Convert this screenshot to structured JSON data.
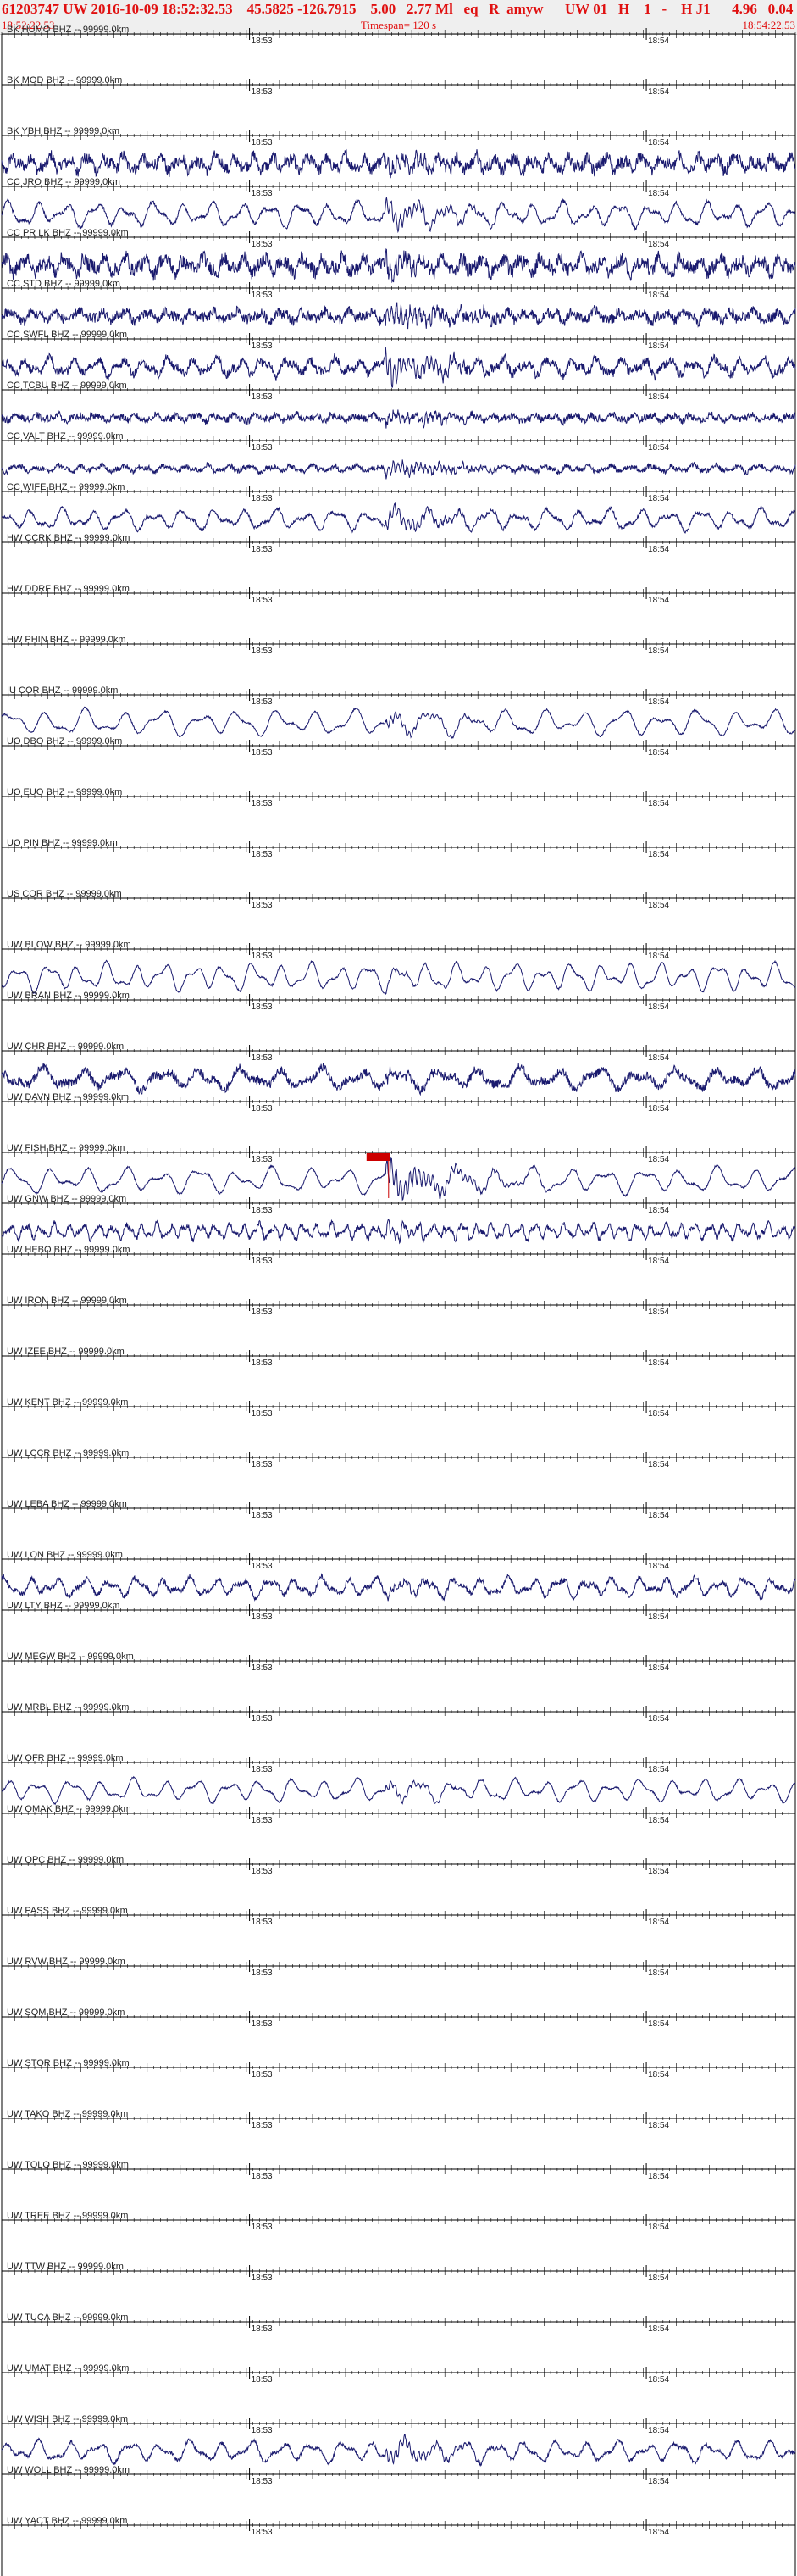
{
  "header": {
    "main": "61203747 UW 2016-10-09 18:52:32.53    45.5825 -126.7915    5.00   2.77 Ml   eq   R  amyw      UW 01   H    1   -    H J1      4.96   0.04",
    "start_time": "18:52:22.53",
    "timespan": "Timespan= 120 s",
    "end_time": "18:54:22.53"
  },
  "colors": {
    "trace": "#1a1a6e",
    "axis": "#000000",
    "header_text": "#e01010",
    "pick": "#cc0000"
  },
  "chart_data": {
    "type": "line",
    "title": "61203747 UW 2016-10-09 18:52:32.53",
    "time_window": [
      "18:52:22.53",
      "18:54:22.53"
    ],
    "timespan_s": 120,
    "minute_marks": [
      "18:53",
      "18:54"
    ],
    "channels": [
      {
        "label": "BK HUMO BHZ -- 99999.0km",
        "amp": 0,
        "noise": 0,
        "period": 0,
        "burst": 0
      },
      {
        "label": "BK MOD BHZ -- 99999.0km",
        "amp": 0,
        "noise": 0,
        "period": 0,
        "burst": 0
      },
      {
        "label": "BK YBH BHZ -- 99999.0km",
        "amp": 9,
        "noise": 7,
        "period": 28,
        "burst": 8
      },
      {
        "label": "CC JRO BHZ -- 99999.0km",
        "amp": 14,
        "noise": 2,
        "period": 44,
        "burst": 10
      },
      {
        "label": "CC PR LK BHZ -- 99999.0km",
        "amp": 10,
        "noise": 8,
        "period": 30,
        "burst": 10
      },
      {
        "label": "CC STD BHZ -- 99999.0km",
        "amp": 6,
        "noise": 6,
        "period": 34,
        "burst": 12
      },
      {
        "label": "CC SWFL BHZ -- 99999.0km",
        "amp": 10,
        "noise": 5,
        "period": 36,
        "burst": 14
      },
      {
        "label": "CC TCBU BHZ -- 99999.0km",
        "amp": 4,
        "noise": 4,
        "period": 30,
        "burst": 8
      },
      {
        "label": "CC VALT BHZ -- 99999.0km",
        "amp": 4,
        "noise": 3,
        "period": 32,
        "burst": 8
      },
      {
        "label": "CC WIFE BHZ -- 99999.0km",
        "amp": 12,
        "noise": 2,
        "period": 46,
        "burst": 8
      },
      {
        "label": "HW CCRK BHZ -- 99999.0km",
        "amp": 0,
        "noise": 0,
        "period": 0,
        "burst": 0
      },
      {
        "label": "HW DDRF BHZ -- 99999.0km",
        "amp": 0,
        "noise": 0,
        "period": 0,
        "burst": 0
      },
      {
        "label": "HW PHIN BHZ -- 99999.0km",
        "amp": 0,
        "noise": 0,
        "period": 0,
        "burst": 0
      },
      {
        "label": "IU COR BHZ -- 99999.0km",
        "amp": 15,
        "noise": 1,
        "period": 58,
        "burst": 5
      },
      {
        "label": "UO DBO BHZ -- 99999.0km",
        "amp": 0,
        "noise": 0,
        "period": 0,
        "burst": 0
      },
      {
        "label": "UO EUO BHZ -- 99999.0km",
        "amp": 0,
        "noise": 0,
        "period": 0,
        "burst": 0
      },
      {
        "label": "UO PIN BHZ -- 99999.0km",
        "amp": 0,
        "noise": 0,
        "period": 0,
        "burst": 0
      },
      {
        "label": "US COR BHZ -- 99999.0km",
        "amp": 0,
        "noise": 0,
        "period": 0,
        "burst": 0
      },
      {
        "label": "UW BLOW BHZ -- 99999.0km",
        "amp": 16,
        "noise": 1,
        "period": 44,
        "burst": 2
      },
      {
        "label": "UW BRAN BHZ -- 99999.0km",
        "amp": 0,
        "noise": 0,
        "period": 0,
        "burst": 0
      },
      {
        "label": "UW CHR BHZ -- 99999.0km",
        "amp": 12,
        "noise": 5,
        "period": 60,
        "burst": 4
      },
      {
        "label": "UW DAVN BHZ -- 99999.0km",
        "amp": 0,
        "noise": 0,
        "period": 0,
        "burst": 0
      },
      {
        "label": "UW FISH BHZ -- 99999.0km",
        "amp": 15,
        "noise": 1,
        "period": 56,
        "burst": 16
      },
      {
        "label": "UW GNW BHZ -- 99999.0km",
        "amp": 9,
        "noise": 3,
        "period": 22,
        "burst": 6
      },
      {
        "label": "UW HEBO BHZ -- 99999.0km",
        "amp": 0,
        "noise": 0,
        "period": 0,
        "burst": 0
      },
      {
        "label": "UW IRON BHZ -- 99999.0km",
        "amp": 0,
        "noise": 0,
        "period": 0,
        "burst": 0
      },
      {
        "label": "UW IZEE BHZ -- 99999.0km",
        "amp": 0,
        "noise": 0,
        "period": 0,
        "burst": 0
      },
      {
        "label": "UW KENT BHZ -- 99999.0km",
        "amp": 0,
        "noise": 0,
        "period": 0,
        "burst": 0
      },
      {
        "label": "UW LCCR BHZ -- 99999.0km",
        "amp": 0,
        "noise": 0,
        "period": 0,
        "burst": 0
      },
      {
        "label": "UW LEBA BHZ -- 99999.0km",
        "amp": 0,
        "noise": 0,
        "period": 0,
        "burst": 0
      },
      {
        "label": "UW LON BHZ -- 99999.0km",
        "amp": 11,
        "noise": 3,
        "period": 40,
        "burst": 4
      },
      {
        "label": "UW LTY BHZ -- 99999.0km",
        "amp": 0,
        "noise": 0,
        "period": 0,
        "burst": 0
      },
      {
        "label": "UW MEGW BHZ -- 99999.0km",
        "amp": 0,
        "noise": 0,
        "period": 0,
        "burst": 0
      },
      {
        "label": "UW MRBL BHZ -- 99999.0km",
        "amp": 0,
        "noise": 0,
        "period": 0,
        "burst": 0
      },
      {
        "label": "UW OFR BHZ -- 99999.0km",
        "amp": 13,
        "noise": 1,
        "period": 48,
        "burst": 4
      },
      {
        "label": "UW OMAK BHZ -- 99999.0km",
        "amp": 0,
        "noise": 0,
        "period": 0,
        "burst": 0
      },
      {
        "label": "UW OPC BHZ -- 99999.0km",
        "amp": 0,
        "noise": 0,
        "period": 0,
        "burst": 0
      },
      {
        "label": "UW PASS BHZ -- 99999.0km",
        "amp": 0,
        "noise": 0,
        "period": 0,
        "burst": 0
      },
      {
        "label": "UW RVW BHZ -- 99999.0km",
        "amp": 0,
        "noise": 0,
        "period": 0,
        "burst": 0
      },
      {
        "label": "UW SQM BHZ -- 99999.0km",
        "amp": 0,
        "noise": 0,
        "period": 0,
        "burst": 0
      },
      {
        "label": "UW STOR BHZ -- 99999.0km",
        "amp": 0,
        "noise": 0,
        "period": 0,
        "burst": 0
      },
      {
        "label": "UW TAKO BHZ -- 99999.0km",
        "amp": 0,
        "noise": 0,
        "period": 0,
        "burst": 0
      },
      {
        "label": "UW TOLO BHZ -- 99999.0km",
        "amp": 0,
        "noise": 0,
        "period": 0,
        "burst": 0
      },
      {
        "label": "UW TREE BHZ -- 99999.0km",
        "amp": 0,
        "noise": 0,
        "period": 0,
        "burst": 0
      },
      {
        "label": "UW TTW BHZ -- 99999.0km",
        "amp": 0,
        "noise": 0,
        "period": 0,
        "burst": 0
      },
      {
        "label": "UW TUCA BHZ -- 99999.0km",
        "amp": 0,
        "noise": 0,
        "period": 0,
        "burst": 0
      },
      {
        "label": "UW UMAT BHZ -- 99999.0km",
        "amp": 0,
        "noise": 0,
        "period": 0,
        "burst": 0
      },
      {
        "label": "UW WISH BHZ -- 99999.0km",
        "amp": 12,
        "noise": 2,
        "period": 46,
        "burst": 8
      },
      {
        "label": "UW WOLL BHZ -- 99999.0km",
        "amp": 0,
        "noise": 0,
        "period": 0,
        "burst": 0
      },
      {
        "label": "UW YACT BHZ -- 99999.0km",
        "amp": 0,
        "noise": 0,
        "period": 0,
        "burst": 0
      }
    ]
  }
}
